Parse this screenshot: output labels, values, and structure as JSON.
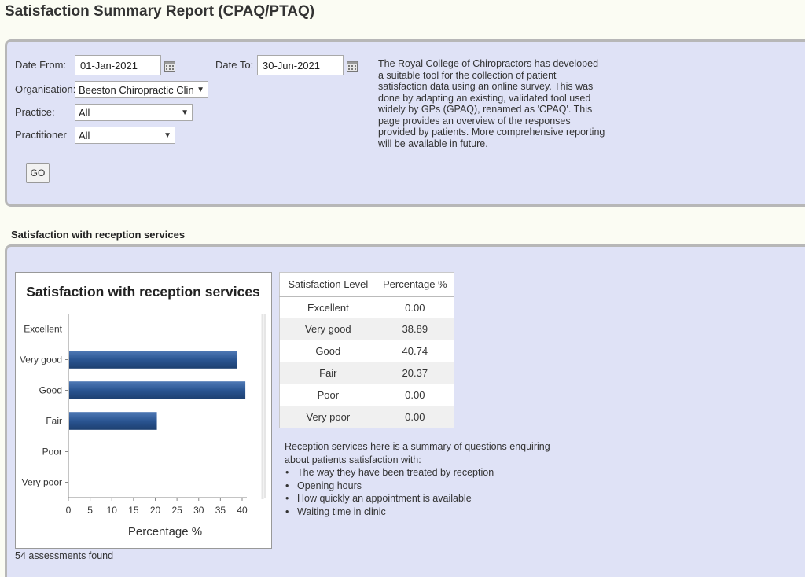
{
  "page": {
    "title": "Satisfaction Summary Report (CPAQ/PTAQ)"
  },
  "filters": {
    "date_from_label": "Date From:",
    "date_from_value": "01-Jan-2021",
    "date_to_label": "Date To:",
    "date_to_value": "30-Jun-2021",
    "organisation_label": "Organisation:",
    "organisation_value": "Beeston Chiropractic Clinic LTD",
    "practice_label": "Practice:",
    "practice_value": "All",
    "practitioner_label": "Practitioner",
    "practitioner_value": "All",
    "go_label": "GO",
    "description": "The Royal College of Chiropractors has developed a suitable tool for the collection of patient satisfaction data using an online survey. This was done by adapting an existing, validated tool used widely by GPs (GPAQ), renamed as 'CPAQ'. This page provides an overview of the responses provided by patients. More comprehensive reporting will be available in future."
  },
  "section": {
    "title": "Satisfaction with reception services"
  },
  "chart_data": {
    "type": "bar",
    "orientation": "horizontal",
    "title": "Satisfaction with reception services",
    "xlabel": "Percentage %",
    "ylabel": "",
    "categories": [
      "Excellent",
      "Very good",
      "Good",
      "Fair",
      "Poor",
      "Very poor"
    ],
    "values": [
      0.0,
      38.89,
      40.74,
      20.37,
      0.0,
      0.0
    ],
    "xlim": [
      0,
      40
    ],
    "xticks": [
      0,
      5,
      10,
      15,
      20,
      25,
      30,
      35,
      40
    ],
    "grid": false,
    "legend": "none",
    "bar_color": "#2a5592"
  },
  "table": {
    "headers": [
      "Satisfaction Level",
      "Percentage %"
    ],
    "rows": [
      [
        "Excellent",
        "0.00"
      ],
      [
        "Very good",
        "38.89"
      ],
      [
        "Good",
        "40.74"
      ],
      [
        "Fair",
        "20.37"
      ],
      [
        "Poor",
        "0.00"
      ],
      [
        "Very poor",
        "0.00"
      ]
    ]
  },
  "summary": {
    "intro": "Reception services here is a summary of questions enquiring about patients satisfaction with:",
    "items": [
      "The way they have been treated by reception",
      "Opening hours",
      "How quickly an appointment is available",
      "Waiting time in clinic"
    ]
  },
  "footer": {
    "count_text": "54 assessments found"
  },
  "icons": {
    "calendar": "calendar-icon",
    "dropdown": "chevron-down-icon"
  }
}
